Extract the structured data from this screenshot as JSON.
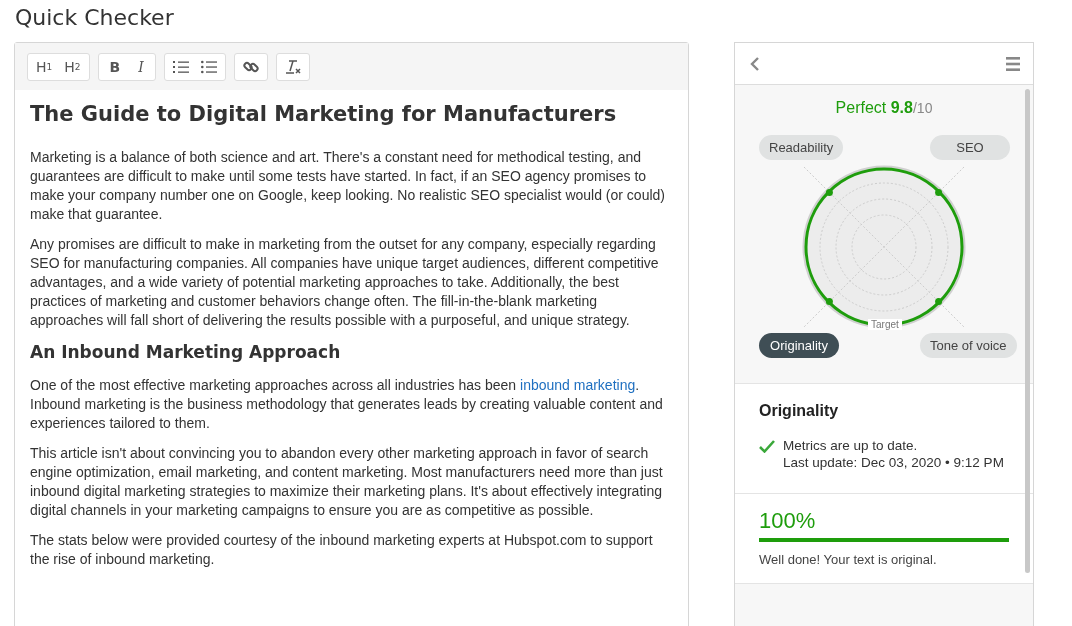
{
  "page_title": "Quick Checker",
  "toolbar": [
    {
      "kind": "h1",
      "label": "H",
      "sub": "1"
    },
    {
      "kind": "h2",
      "label": "H",
      "sub": "2"
    },
    {
      "kind": "bold",
      "label": "B"
    },
    {
      "kind": "italic",
      "label": "I"
    },
    {
      "kind": "ordered-list"
    },
    {
      "kind": "bullet-list"
    },
    {
      "kind": "link"
    },
    {
      "kind": "clear-format"
    }
  ],
  "blocks": [
    {
      "kind": "h1",
      "segments": [
        {
          "kind": "text",
          "text": "The Guide to Digital Marketing for Manufacturers"
        }
      ]
    },
    {
      "kind": "p",
      "segments": [
        {
          "kind": "text",
          "text": "Marketing is a balance of both science and art. There's a constant need for methodical testing, and guarantees are difficult to make until some tests have started. In fact, if an SEO agency promises to make your company number one on Google, keep looking. No realistic SEO specialist would (or could) make that guarantee."
        }
      ]
    },
    {
      "kind": "p",
      "segments": [
        {
          "kind": "text",
          "text": "Any promises are difficult to make in marketing from the outset for any company, especially regarding SEO for manufacturing companies. All companies have unique target audiences, different competitive advantages, and a wide variety of potential marketing approaches to take. Additionally, the best practices of marketing and customer behaviors change often. The fill-in-the-blank marketing approaches will fall short of delivering the results possible with a purposeful, and unique strategy."
        }
      ]
    },
    {
      "kind": "h2",
      "segments": [
        {
          "kind": "text",
          "text": "An Inbound Marketing Approach"
        }
      ]
    },
    {
      "kind": "p",
      "segments": [
        {
          "kind": "text",
          "text": "One of the most effective marketing approaches across all industries has been "
        },
        {
          "kind": "link",
          "text": "inbound marketing"
        },
        {
          "kind": "text",
          "text": ". Inbound marketing is the business methodology that generates leads by creating valuable content and experiences tailored to them."
        }
      ]
    },
    {
      "kind": "p",
      "segments": [
        {
          "kind": "text",
          "text": "This article isn't about convincing you to abandon every other marketing approach in favor of search engine optimization, email marketing, and content marketing. Most manufacturers need more than just inbound digital marketing strategies to maximize their marketing plans. It's about effectively integrating digital channels in your marketing campaigns to ensure you are as competitive as possible."
        }
      ]
    },
    {
      "kind": "p",
      "segments": [
        {
          "kind": "text",
          "text": "The stats below were provided courtesy of the inbound marketing experts at Hubspot.com to support the rise of inbound marketing."
        }
      ]
    }
  ],
  "panel": {
    "score": {
      "label": "Perfect",
      "value": "9.8",
      "max": "/10"
    },
    "metrics": [
      {
        "label": "Readability",
        "selected": false
      },
      {
        "label": "SEO",
        "selected": false
      },
      {
        "label": "Originality",
        "selected": true
      },
      {
        "label": "Tone of voice",
        "selected": false
      }
    ],
    "target_label": "Target",
    "detail": {
      "title": "Originality",
      "status": "Metrics are up to date.",
      "updated": "Last update: Dec 03, 2020 • 9:12 PM",
      "percent": "100%",
      "level": 1,
      "message": "Well done! Your text is original."
    }
  }
}
